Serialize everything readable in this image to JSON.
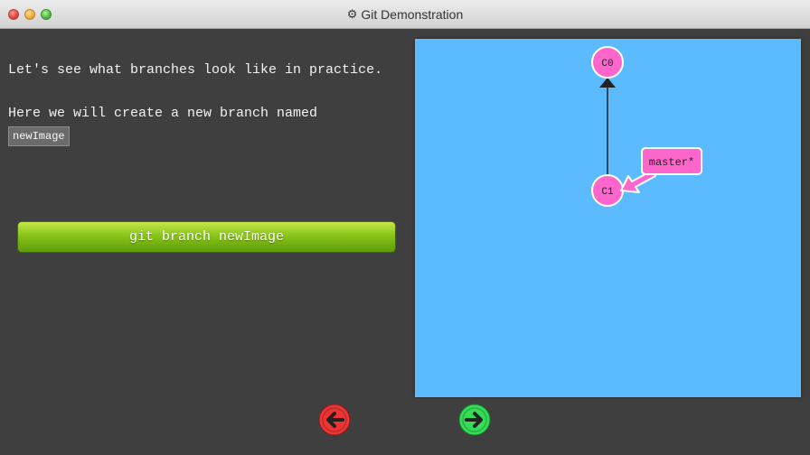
{
  "window": {
    "title": "Git Demonstration",
    "title_icon": "gear-icon"
  },
  "instructions": {
    "paragraph1": "Let's see what branches look like in practice.",
    "paragraph2": "Here we will create a new branch named",
    "code_chip": "newImage"
  },
  "command": {
    "label": "git branch newImage"
  },
  "graph": {
    "commits": [
      {
        "id": "C0"
      },
      {
        "id": "C1"
      }
    ],
    "branch": {
      "label": "master*",
      "target": "C1"
    }
  },
  "nav": {
    "prev_icon": "arrow-left-icon",
    "next_icon": "arrow-right-icon"
  },
  "colors": {
    "canvas_bg": "#5cbbff",
    "commit_fill": "#ff66cc",
    "branch_fill": "#ff66cc",
    "button_green": "#88c418",
    "prev_red": "#ee3333",
    "next_green": "#33dd55",
    "panel_bg": "#3f3f3f"
  }
}
